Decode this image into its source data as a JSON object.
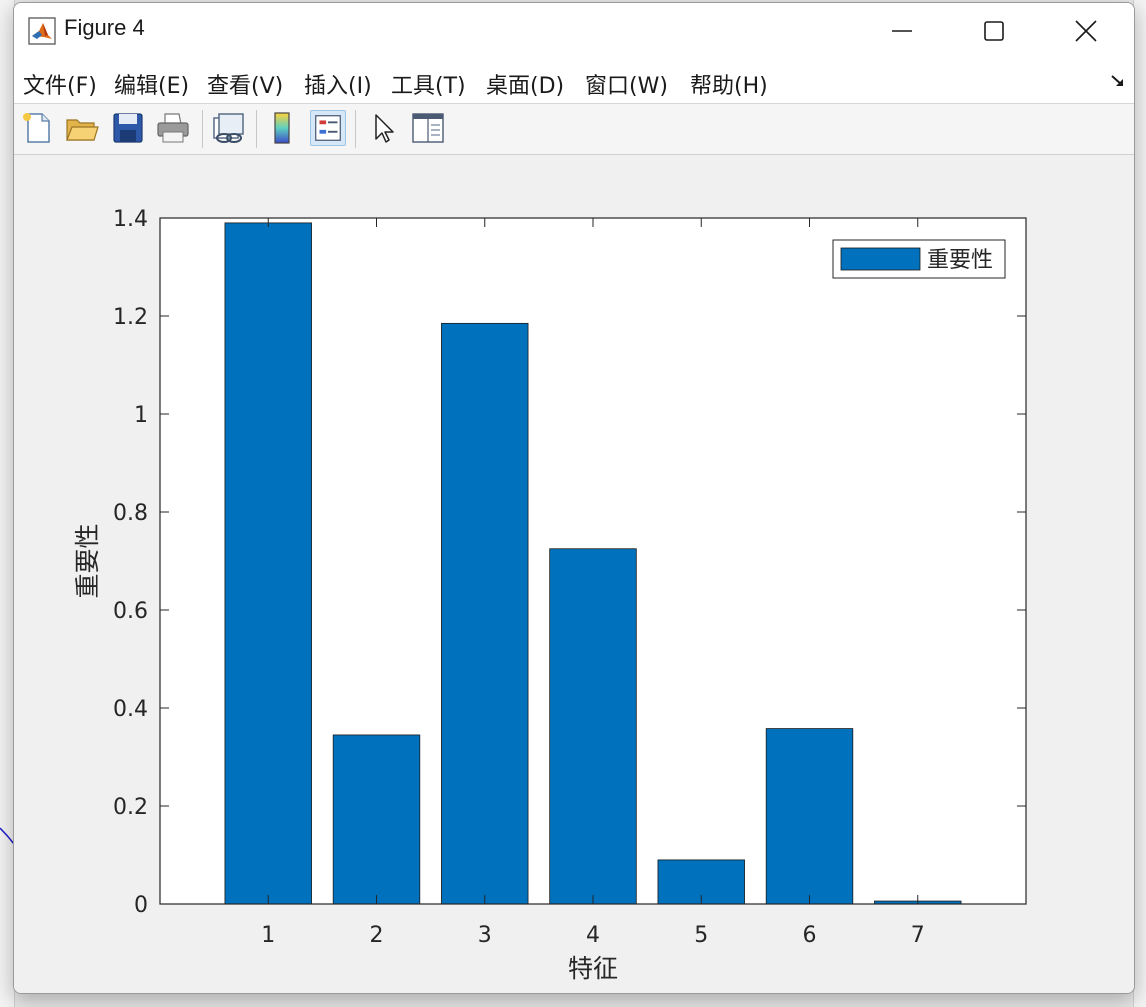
{
  "window": {
    "title": "Figure 4"
  },
  "menu": {
    "items": [
      "文件(F)",
      "编辑(E)",
      "查看(V)",
      "插入(I)",
      "工具(T)",
      "桌面(D)",
      "窗口(W)",
      "帮助(H)"
    ]
  },
  "toolbar": {
    "buttons": [
      "new-figure-icon",
      "open-file-icon",
      "save-icon",
      "print-icon",
      "link-plot-icon",
      "colorbar-icon",
      "legend-icon",
      "edit-plot-arrow-icon",
      "property-inspector-icon"
    ],
    "active": "legend-icon"
  },
  "colors": {
    "bar_fill": "#0072BD",
    "axes_edge": "#262626"
  },
  "chart_data": {
    "type": "bar",
    "categories": [
      "1",
      "2",
      "3",
      "4",
      "5",
      "6",
      "7"
    ],
    "values": [
      1.39,
      0.345,
      1.185,
      0.725,
      0.09,
      0.358,
      0.006
    ],
    "xlabel": "特征",
    "ylabel": "重要性",
    "ylim": [
      0,
      1.4
    ],
    "xlim": [
      0,
      8
    ],
    "yticks": [
      "0",
      "0.2",
      "0.4",
      "0.6",
      "0.8",
      "1",
      "1.2",
      "1.4"
    ],
    "legend": [
      "重要性"
    ],
    "legend_position": "top-right",
    "grid": false
  }
}
